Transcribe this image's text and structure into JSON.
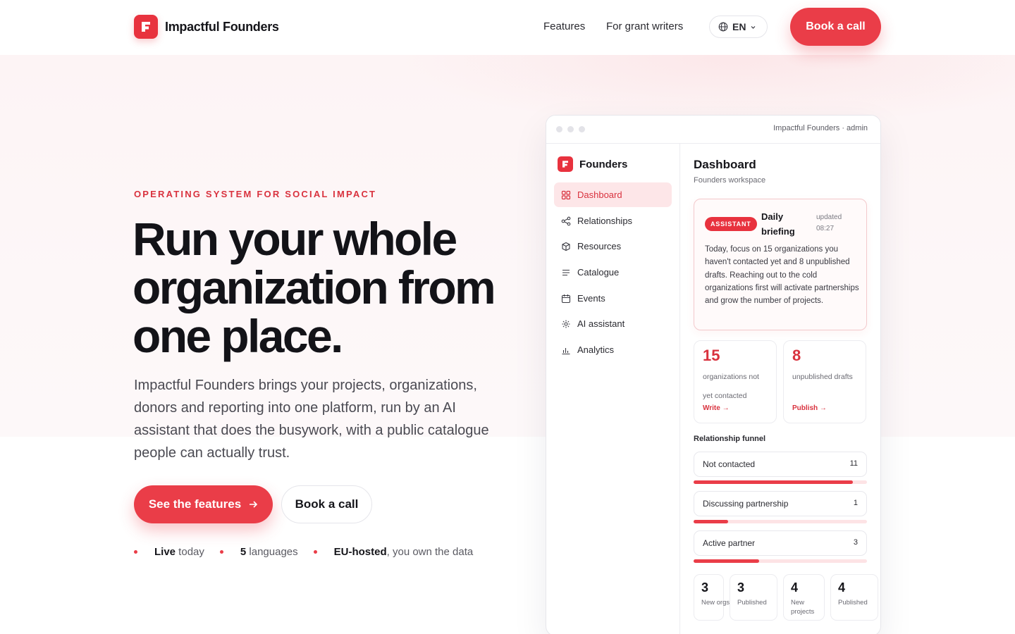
{
  "brand": {
    "name": "Impactful Founders",
    "logo_letter": "F"
  },
  "nav": {
    "links": [
      "Features",
      "For grant writers"
    ],
    "language": "EN",
    "cta": "Book a call"
  },
  "hero": {
    "eyebrow": "OPERATING SYSTEM FOR SOCIAL IMPACT",
    "headline": "Run your whole organization from one place.",
    "lead": "Impactful Founders brings your projects, organizations, donors and reporting into one platform, run by an AI assistant that does the busywork, with a public catalogue people can actually trust.",
    "primary_cta": "See the features",
    "secondary_cta": "Book a call",
    "facts": [
      {
        "strong": "Live",
        "rest": " today"
      },
      {
        "strong": "5",
        "rest": " languages"
      },
      {
        "strong": "EU-hosted",
        "rest": ", you own the data"
      }
    ]
  },
  "app": {
    "window_title": "Impactful Founders · admin",
    "sidebar": {
      "workspace": "Founders",
      "items": [
        {
          "label": "Dashboard",
          "icon": "grid-icon",
          "active": true
        },
        {
          "label": "Relationships",
          "icon": "share-icon",
          "active": false
        },
        {
          "label": "Resources",
          "icon": "box-icon",
          "active": false
        },
        {
          "label": "Catalogue",
          "icon": "list-icon",
          "active": false
        },
        {
          "label": "Events",
          "icon": "calendar-icon",
          "active": false
        },
        {
          "label": "AI assistant",
          "icon": "sparkle-icon",
          "active": false
        },
        {
          "label": "Analytics",
          "icon": "bar-chart-icon",
          "active": false
        }
      ]
    },
    "dashboard": {
      "title": "Dashboard",
      "subtitle": "Founders workspace",
      "briefing": {
        "badge": "ASSISTANT",
        "title": "Daily briefing",
        "updated": "updated 08:27",
        "text": "Today, focus on 15 organizations you haven't contacted yet and 8 unpublished drafts. Reaching out to the cold organizations first will activate partnerships and grow the number of projects."
      },
      "stats": [
        {
          "value": "15",
          "label": "organizations not yet contacted",
          "action": "Write →"
        },
        {
          "value": "8",
          "label": "unpublished drafts",
          "action": "Publish →"
        }
      ],
      "funnel": {
        "title": "Relationship funnel",
        "rows": [
          {
            "label": "Not contacted",
            "count": "11",
            "fraction": 0.92
          },
          {
            "label": "Discussing partnership",
            "count": "1",
            "fraction": 0.2
          },
          {
            "label": "Active partner",
            "count": "3",
            "fraction": 0.38
          }
        ]
      },
      "mini_stats": [
        {
          "value": "3",
          "label": "New orgs"
        },
        {
          "value": "3",
          "label": "Published"
        },
        {
          "value": "4",
          "label": "New projects"
        },
        {
          "value": "4",
          "label": "Published"
        }
      ]
    }
  },
  "colors": {
    "accent": "#ea3d48",
    "accent_soft": "#fde6e8",
    "text": "#15151a"
  }
}
